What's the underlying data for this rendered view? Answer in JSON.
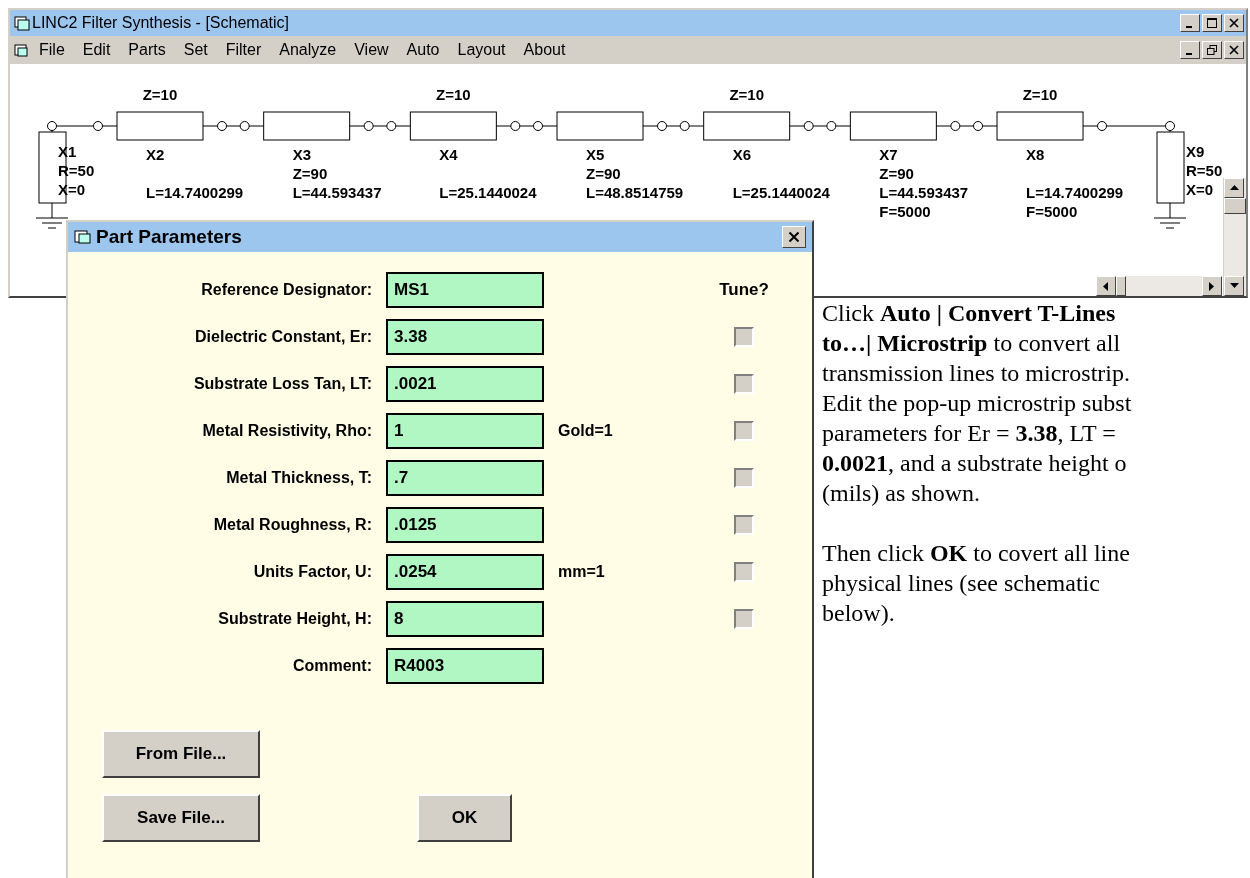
{
  "window": {
    "title": "LINC2 Filter Synthesis - [Schematic]"
  },
  "menu": [
    "File",
    "Edit",
    "Parts",
    "Set",
    "Filter",
    "Analyze",
    "View",
    "Auto",
    "Layout",
    "About"
  ],
  "schematic": {
    "source": {
      "designator": "X1",
      "resistance": "R=50",
      "reactance": "X=0"
    },
    "lines": [
      {
        "designator": "X2",
        "z_top": "Z=10",
        "length": "L=14.7400299"
      },
      {
        "designator": "X3",
        "z_bottom": "Z=90",
        "length": "L=44.593437"
      },
      {
        "designator": "X4",
        "z_top": "Z=10",
        "length": "L=25.1440024"
      },
      {
        "designator": "X5",
        "z_bottom": "Z=90",
        "length": "L=48.8514759"
      },
      {
        "designator": "X6",
        "z_top": "Z=10",
        "length": "L=25.1440024"
      },
      {
        "designator": "X7",
        "z_bottom": "Z=90",
        "length": "L=44.593437",
        "frequency": "F=5000"
      },
      {
        "designator": "X8",
        "z_top": "Z=10",
        "length": "L=14.7400299",
        "frequency": "F=5000"
      }
    ],
    "load": {
      "designator": "X9",
      "resistance": "R=50",
      "reactance": "X=0"
    }
  },
  "dialog": {
    "title": "Part Parameters",
    "tune_heading": "Tune?",
    "rows": [
      {
        "label": "Reference Designator:",
        "value": "MS1"
      },
      {
        "label": "Dielectric Constant, Er:",
        "value": "3.38",
        "tune": {
          "checked": false,
          "disabled": true
        }
      },
      {
        "label": "Substrate Loss Tan, LT:",
        "value": ".0021",
        "tune": {
          "checked": false,
          "disabled": true
        }
      },
      {
        "label": "Metal Resistivity, Rho:",
        "value": "1",
        "note": "Gold=1",
        "tune": {
          "checked": false,
          "disabled": true
        }
      },
      {
        "label": "Metal Thickness, T:",
        "value": ".7",
        "tune": {
          "checked": false,
          "disabled": true
        }
      },
      {
        "label": "Metal Roughness, R:",
        "value": ".0125",
        "tune": {
          "checked": false,
          "disabled": true
        }
      },
      {
        "label": "Units Factor, U:",
        "value": ".0254",
        "note": "mm=1",
        "tune": {
          "checked": false,
          "disabled": true
        }
      },
      {
        "label": "Substrate Height, H:",
        "value": "8",
        "tune": {
          "checked": false,
          "disabled": true
        }
      },
      {
        "label": "Comment:",
        "value": "R4003"
      }
    ],
    "buttons": {
      "from_file": "From File...",
      "save_file": "Save File...",
      "ok": "OK"
    }
  },
  "instructions": [
    {
      "lines": [
        "Click **Auto | Convert T-Lines**",
        "**to…| Microstrip** to convert all",
        "transmission lines to microstrip.",
        "Edit the pop-up microstrip subst",
        "parameters for Er = **3.38**, LT =",
        "**0.0021**, and a substrate height o",
        "(mils) as shown."
      ]
    },
    {
      "lines": [
        "Then click **OK** to covert all line",
        "physical lines (see schematic",
        "below)."
      ]
    }
  ]
}
